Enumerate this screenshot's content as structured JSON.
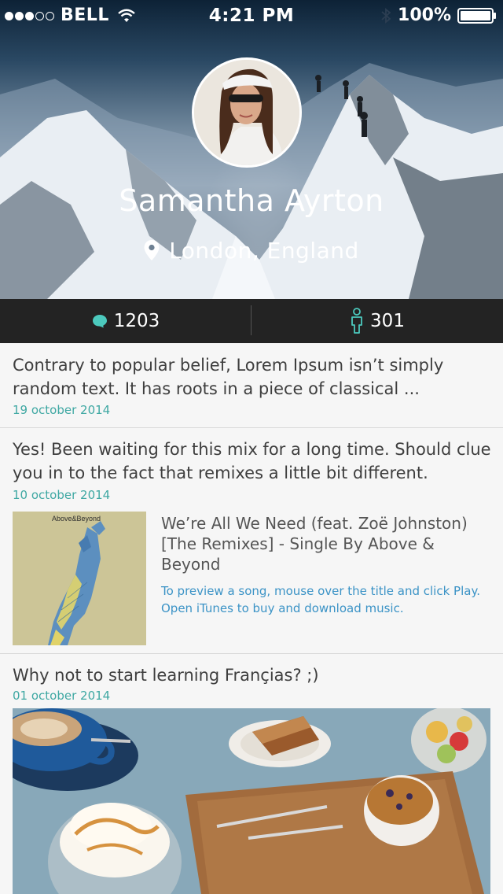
{
  "status_bar": {
    "carrier": "BELL",
    "time": "4:21 PM",
    "battery": "100%"
  },
  "profile": {
    "name": "Samantha Ayrton",
    "location": "London, England"
  },
  "stats": {
    "comments": "1203",
    "followers": "301"
  },
  "colors": {
    "accent": "#3fa8a3",
    "link": "#3b93c6",
    "stats_bg": "#232323",
    "icon_teal": "#4cc9bd"
  },
  "posts": [
    {
      "text": "Contrary to popular belief, Lorem Ipsum isn’t simply random text. It has roots in a piece of classical ...",
      "date": "19 october 2014"
    },
    {
      "text": "Yes! Been waiting for this mix for a long time. Should clue you in to the fact that remixes a little bit different.",
      "date": "10 october 2014",
      "album": {
        "title": "We’re All We Need (feat. Zoë Johnston) [The Remixes] - Single By Above & Beyond",
        "description": "To preview a song, mouse over the title and click Play. Open iTunes to buy and download music.",
        "art_text": "Above&Beyond"
      }
    },
    {
      "text": "Why not to start learning Françias? ;)",
      "date": "01 october 2014"
    }
  ]
}
